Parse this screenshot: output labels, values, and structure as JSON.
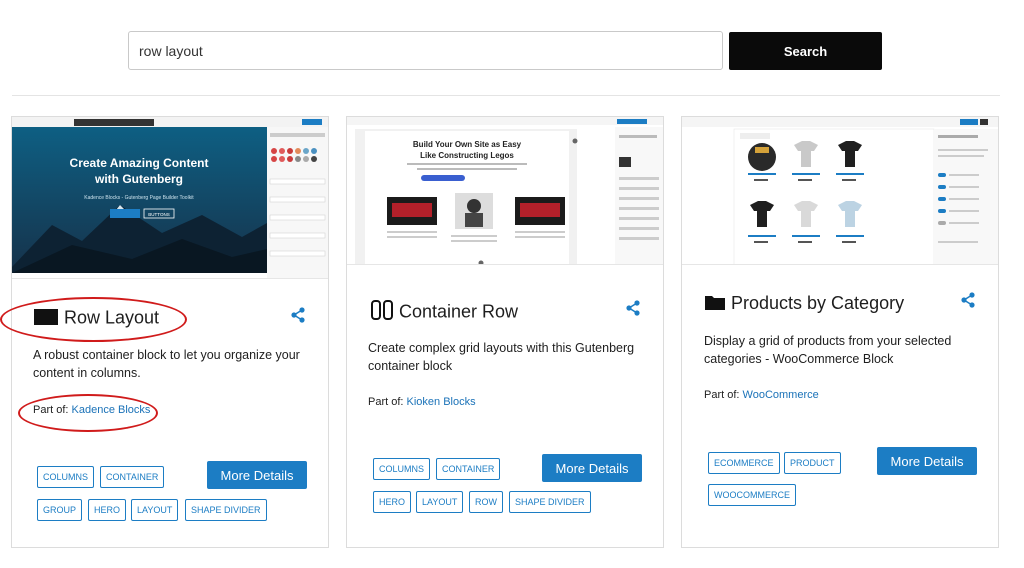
{
  "search": {
    "value": "row layout",
    "button_label": "Search"
  },
  "cards": [
    {
      "title": "Row Layout",
      "description": "A robust container block to let you organize your content in columns.",
      "part_of_label": "Part of:",
      "part_of_link": "Kadence Blocks",
      "details_label": "More Details",
      "tags": [
        "COLUMNS",
        "CONTAINER",
        "GROUP",
        "HERO",
        "LAYOUT",
        "SHAPE DIVIDER"
      ],
      "preview": {
        "headline": "Create Amazing Content with Gutenberg",
        "sub": "Kadence Blocks - Gutenberg Page Builder Toolkit",
        "button": "BUTTONS"
      }
    },
    {
      "title": "Container Row",
      "description": "Create complex grid layouts with this Gutenberg container block",
      "part_of_label": "Part of:",
      "part_of_link": "Kioken Blocks",
      "details_label": "More Details",
      "tags": [
        "COLUMNS",
        "CONTAINER",
        "HERO",
        "LAYOUT",
        "ROW",
        "SHAPE DIVIDER"
      ],
      "preview": {
        "headline": "Build Your Own Site as Easy Like Constructing Legos"
      }
    },
    {
      "title": "Products by Category",
      "description": "Display a grid of products from your selected categories - WooCommerce Block",
      "part_of_label": "Part of:",
      "part_of_link": "WooCommerce",
      "details_label": "More Details",
      "tags": [
        "ECOMMERCE",
        "PRODUCT",
        "WOOCOMMERCE"
      ],
      "preview": {
        "products": [
          "Beanie",
          "Hoodie",
          "Hoodie",
          "T-Shirt",
          "Shirt",
          "T-Shirt"
        ]
      }
    }
  ],
  "colors": {
    "accent": "#1c7dc4",
    "annotation": "#d01b1b",
    "search_button": "#0a0a0a"
  }
}
